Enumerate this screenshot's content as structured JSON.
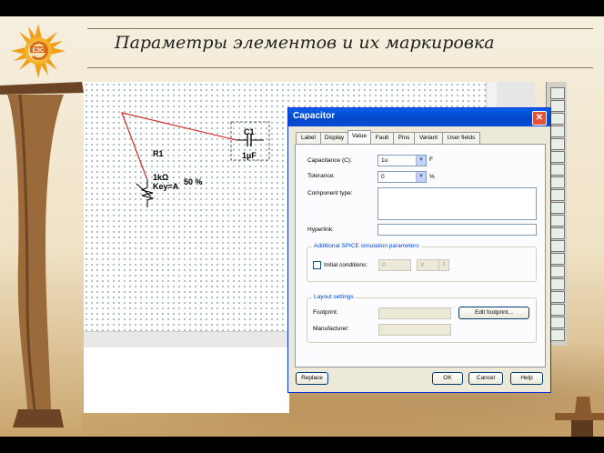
{
  "slide": {
    "title": "Параметры элементов и их маркировка"
  },
  "schematic": {
    "cap_ref": "C1",
    "cap_value": "1µF",
    "res_ref": "R1",
    "res_value": "1kΩ",
    "res_key": "Key=A",
    "res_percent": "50 %"
  },
  "dialog": {
    "title": "Capacitor",
    "close_label": "✕",
    "tabs": [
      {
        "label": "Label"
      },
      {
        "label": "Display"
      },
      {
        "label": "Value"
      },
      {
        "label": "Fault"
      },
      {
        "label": "Pins"
      },
      {
        "label": "Variant"
      },
      {
        "label": "User fields"
      }
    ],
    "active_tab": "Value",
    "fields": {
      "capacitance_label": "Capacitance (C):",
      "capacitance_value": "1u",
      "capacitance_unit": "F",
      "tolerance_label": "Tolerance:",
      "tolerance_value": "0",
      "tolerance_unit": "%",
      "component_type_label": "Component type:",
      "component_type_value": "",
      "hyperlink_label": "Hyperlink:",
      "hyperlink_value": ""
    },
    "spice": {
      "group_label": "Additional SPICE simulation parameters",
      "initial_conditions_label": "Initial conditions:",
      "initial_conditions_value": "0",
      "unit_value": "V"
    },
    "layout": {
      "group_label": "Layout settings",
      "footprint_label": "Footprint:",
      "footprint_value": "",
      "manufacturer_label": "Manufacturer:",
      "manufacturer_value": "",
      "edit_footprint_label": "Edit footprint..."
    },
    "buttons": {
      "replace": "Replace",
      "ok": "OK",
      "cancel": "Cancel",
      "help": "Help"
    }
  },
  "colors": {
    "titlebar": "#0347c9",
    "wire": "#d42a2a",
    "group_label": "#0046d5"
  }
}
